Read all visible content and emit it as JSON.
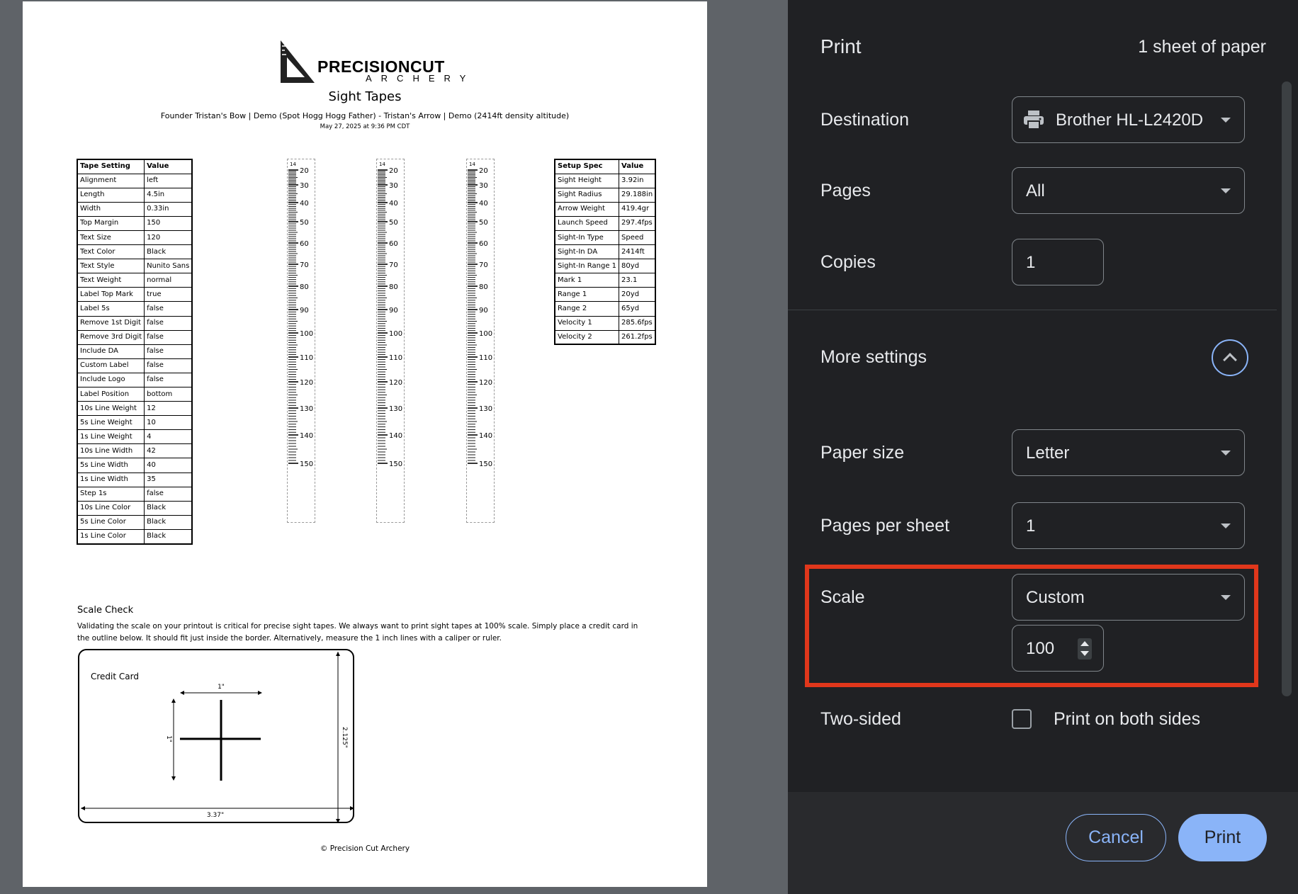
{
  "document": {
    "logo": {
      "word": "PRECISIONCUT",
      "sub": "ARCHERY"
    },
    "title": "Sight Tapes",
    "subtitle": "Founder Tristan's Bow | Demo (Spot Hogg Hogg Father) - Tristan's Arrow | Demo (2414ft density altitude)",
    "date": "May 27, 2025 at 9:36 PM CDT",
    "tape_settings": {
      "headers": [
        "Tape Setting",
        "Value"
      ],
      "rows": [
        [
          "Alignment",
          "left"
        ],
        [
          "Length",
          "4.5in"
        ],
        [
          "Width",
          "0.33in"
        ],
        [
          "Top Margin",
          "150"
        ],
        [
          "Text Size",
          "120"
        ],
        [
          "Text Color",
          "Black"
        ],
        [
          "Text Style",
          "Nunito Sans"
        ],
        [
          "Text Weight",
          "normal"
        ],
        [
          "Label Top Mark",
          "true"
        ],
        [
          "Label 5s",
          "false"
        ],
        [
          "Remove 1st Digit",
          "false"
        ],
        [
          "Remove 3rd Digit",
          "false"
        ],
        [
          "Include DA",
          "false"
        ],
        [
          "Custom Label",
          "false"
        ],
        [
          "Include Logo",
          "false"
        ],
        [
          "Label Position",
          "bottom"
        ],
        [
          "10s Line Weight",
          "12"
        ],
        [
          "5s Line Weight",
          "10"
        ],
        [
          "1s Line Weight",
          "4"
        ],
        [
          "10s Line Width",
          "42"
        ],
        [
          "5s Line Width",
          "40"
        ],
        [
          "1s Line Width",
          "35"
        ],
        [
          "Step 1s",
          "false"
        ],
        [
          "10s Line Color",
          "Black"
        ],
        [
          "5s Line Color",
          "Black"
        ],
        [
          "1s Line Color",
          "Black"
        ]
      ]
    },
    "setup_specs": {
      "headers": [
        "Setup Spec",
        "Value"
      ],
      "rows": [
        [
          "Sight Height",
          "3.92in"
        ],
        [
          "Sight Radius",
          "29.188in"
        ],
        [
          "Arrow Weight",
          "419.4gr"
        ],
        [
          "Launch Speed",
          "297.4fps"
        ],
        [
          "Sight-In Type",
          "Speed"
        ],
        [
          "Sight-In DA",
          "2414ft"
        ],
        [
          "Sight-In Range 1",
          "80yd"
        ],
        [
          "Mark 1",
          "23.1"
        ],
        [
          "Range 1",
          "20yd"
        ],
        [
          "Range 2",
          "65yd"
        ],
        [
          "Velocity 1",
          "285.6fps"
        ],
        [
          "Velocity 2",
          "261.2fps"
        ]
      ]
    },
    "tape": {
      "top_mark": "14",
      "labels": [
        "20",
        "30",
        "40",
        "50",
        "60",
        "70",
        "80",
        "90",
        "100",
        "110",
        "120",
        "130",
        "140",
        "150"
      ]
    },
    "scale_check": {
      "title": "Scale Check",
      "text": "Validating the scale on your printout is critical for precise sight tapes. We always want to print sight tapes at 100% scale. Simply place a credit card in the outline below. It should fit just inside the border. Alternatively, measure the 1 inch lines with a caliper or ruler.",
      "card_label": "Credit Card",
      "dim_1in_h": "1\"",
      "dim_1in_v": "1\"",
      "dim_height": "2.125\"",
      "dim_width": "3.37\""
    },
    "copyright": "© Precision Cut Archery"
  },
  "panel": {
    "title": "Print",
    "sheet_count": "1 sheet of paper",
    "destination": {
      "label": "Destination",
      "value": "Brother HL-L2420D",
      "icon": "printer-icon"
    },
    "pages": {
      "label": "Pages",
      "value": "All"
    },
    "copies": {
      "label": "Copies",
      "value": "1"
    },
    "more_settings": {
      "label": "More settings",
      "icon": "chevron-up-icon"
    },
    "paper_size": {
      "label": "Paper size",
      "value": "Letter"
    },
    "pages_per_sheet": {
      "label": "Pages per sheet",
      "value": "1"
    },
    "scale": {
      "label": "Scale",
      "value": "Custom",
      "custom_value": "100"
    },
    "two_sided": {
      "label": "Two-sided",
      "option": "Print on both sides",
      "checked": false
    },
    "buttons": {
      "cancel": "Cancel",
      "print": "Print"
    },
    "colors": {
      "accent": "#8ab4f8",
      "highlight": "#e0371b",
      "panel_bg": "#202124"
    }
  }
}
